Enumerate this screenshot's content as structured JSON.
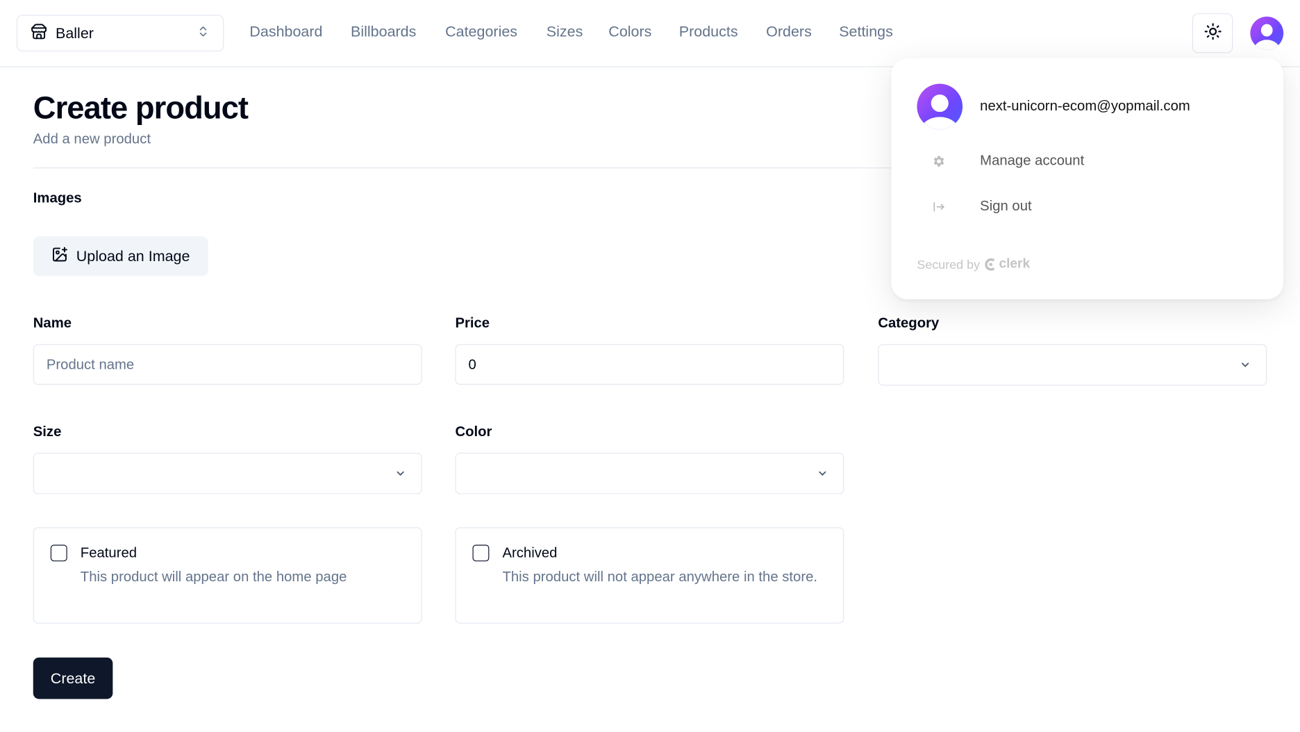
{
  "header": {
    "store_switcher": {
      "value": "Baller",
      "icon": "store-icon"
    },
    "nav": [
      {
        "label": "Dashboard"
      },
      {
        "label": "Billboards"
      },
      {
        "label": "Categories"
      },
      {
        "label": "Sizes"
      },
      {
        "label": "Colors"
      },
      {
        "label": "Products"
      },
      {
        "label": "Orders"
      },
      {
        "label": "Settings"
      }
    ],
    "theme_toggle_icon": "sun-icon"
  },
  "page": {
    "title": "Create product",
    "subtitle": "Add a new product"
  },
  "form": {
    "images_label": "Images",
    "upload_label": "Upload an Image",
    "name": {
      "label": "Name",
      "placeholder": "Product name",
      "value": ""
    },
    "price": {
      "label": "Price",
      "value": "0"
    },
    "category": {
      "label": "Category",
      "value": ""
    },
    "size": {
      "label": "Size",
      "value": ""
    },
    "color": {
      "label": "Color",
      "value": ""
    },
    "featured": {
      "title": "Featured",
      "description": "This product will appear on the home page",
      "checked": false
    },
    "archived": {
      "title": "Archived",
      "description": "This product will not appear anywhere in the store.",
      "checked": false
    },
    "submit_label": "Create"
  },
  "user_menu": {
    "email": "next-unicorn-ecom@yopmail.com",
    "items": [
      {
        "label": "Manage account",
        "icon": "gear-icon"
      },
      {
        "label": "Sign out",
        "icon": "sign-out-icon"
      }
    ],
    "secured_by": "Secured by",
    "brand": "clerk"
  },
  "colors": {
    "primary": "#0f172a",
    "muted_text": "#64748b",
    "border": "#e2e8f0",
    "avatar_gradient": [
      "#a34bf5",
      "#4f5bff"
    ]
  }
}
